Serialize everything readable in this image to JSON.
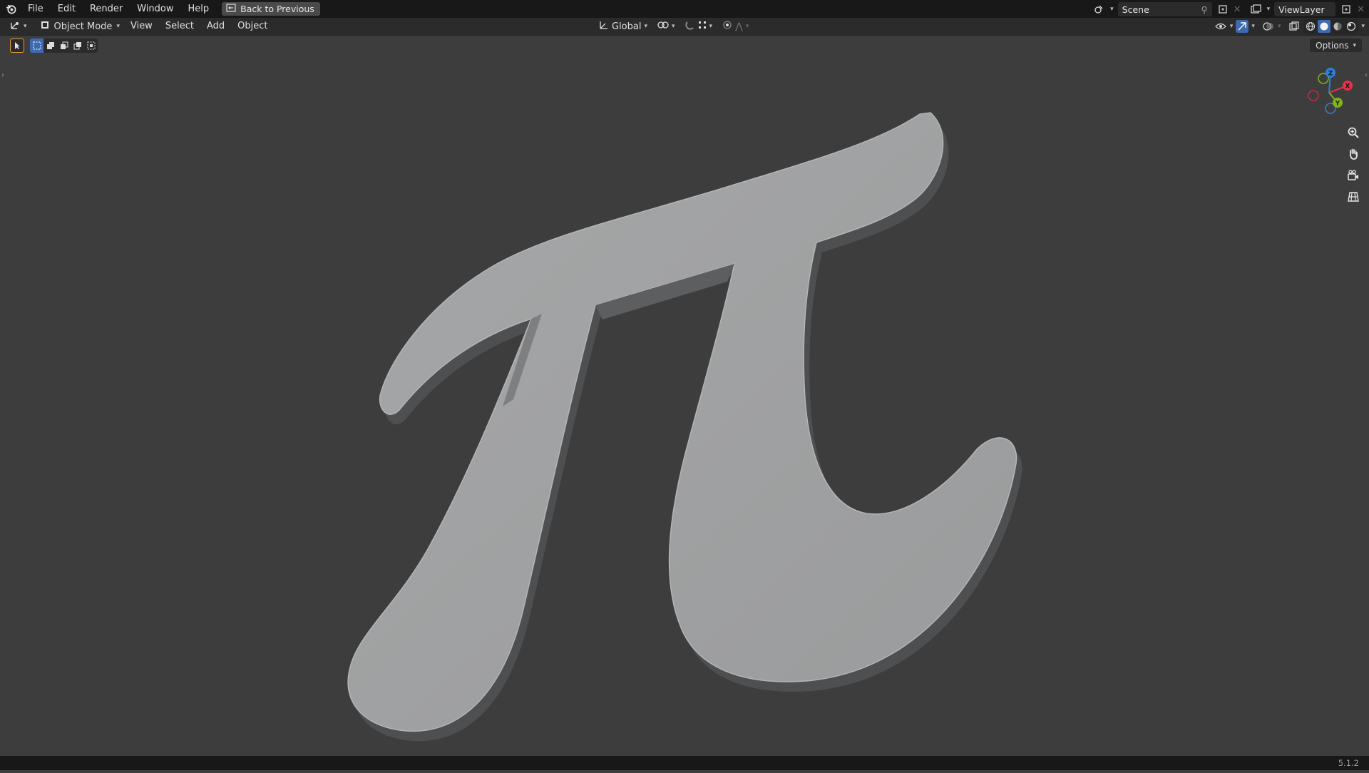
{
  "topbar": {
    "menus": [
      "File",
      "Edit",
      "Render",
      "Window",
      "Help"
    ],
    "back_button": "Back to Previous",
    "scene": "Scene",
    "view_layer": "ViewLayer"
  },
  "header": {
    "mode": "Object Mode",
    "menus": [
      "View",
      "Select",
      "Add",
      "Object"
    ],
    "transform_orientation": "Global",
    "options_label": "Options"
  },
  "viewport": {
    "object": "π",
    "gizmo_axes": [
      "X",
      "Y",
      "Z"
    ]
  },
  "status": {
    "version": "5.1.2"
  },
  "colors": {
    "accent": "#3f6ab0",
    "active_tool_border": "#e59e36",
    "axis_x": "#e8324a",
    "axis_y": "#80b31f",
    "axis_z": "#2f7fd6",
    "background": "#3d3d3d",
    "object": "#9d9e9f"
  },
  "icons": {
    "logo": "blender-logo-icon",
    "zoom": "zoom-icon",
    "pan": "hand-icon",
    "camera": "camera-icon",
    "ortho": "grid-icon"
  }
}
